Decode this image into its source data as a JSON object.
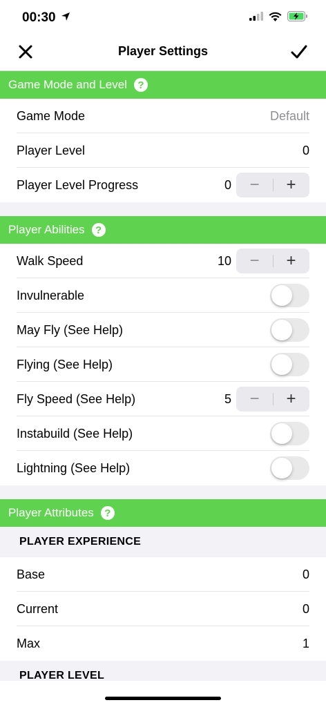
{
  "status_bar": {
    "time": "00:30"
  },
  "nav": {
    "title": "Player Settings"
  },
  "sections": {
    "game_mode": {
      "title": "Game Mode and Level",
      "help": "?"
    },
    "abilities": {
      "title": "Player Abilities",
      "help": "?"
    },
    "attributes": {
      "title": "Player Attributes",
      "help": "?"
    }
  },
  "game_mode": {
    "game_mode_label": "Game Mode",
    "game_mode_value": "Default",
    "player_level_label": "Player Level",
    "player_level_value": "0",
    "progress_label": "Player Level Progress",
    "progress_value": "0"
  },
  "abilities": {
    "walk_speed_label": "Walk Speed",
    "walk_speed_value": "10",
    "invulnerable_label": "Invulnerable",
    "may_fly_label": "May Fly (See Help)",
    "flying_label": "Flying (See Help)",
    "fly_speed_label": "Fly Speed (See Help)",
    "fly_speed_value": "5",
    "instabuild_label": "Instabuild (See Help)",
    "lightning_label": "Lightning (See Help)"
  },
  "toggles": {
    "invulnerable": false,
    "may_fly": false,
    "flying": false,
    "instabuild": false,
    "lightning": false
  },
  "stepper": {
    "minus": "−",
    "plus": "+"
  },
  "attributes": {
    "experience_header": "PLAYER EXPERIENCE",
    "base_label": "Base",
    "base_value": "0",
    "current_label": "Current",
    "current_value": "0",
    "max_label": "Max",
    "max_value": "1",
    "level_header": "PLAYER LEVEL"
  },
  "colors": {
    "accent": "#5fd34f"
  }
}
